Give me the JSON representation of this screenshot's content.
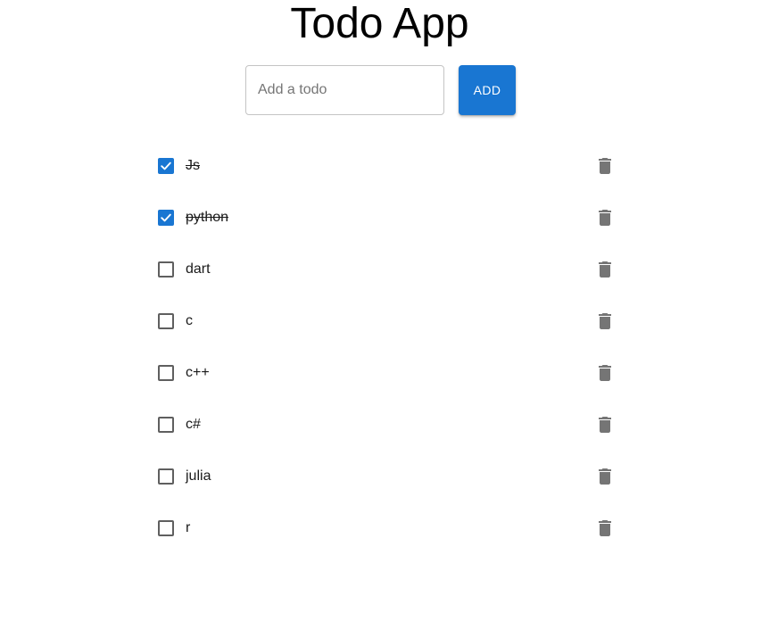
{
  "header": {
    "title": "Todo App"
  },
  "new_todo": {
    "placeholder": "Add a todo",
    "value": "",
    "add_label": "ADD"
  },
  "colors": {
    "accent": "#1976d2",
    "icon": "#757575",
    "checkbox_border": "#5f5f5f"
  },
  "todos": [
    {
      "text": "Js",
      "completed": true,
      "delete_icon": "trash-icon"
    },
    {
      "text": "python",
      "completed": true,
      "delete_icon": "trash-icon"
    },
    {
      "text": "dart",
      "completed": false,
      "delete_icon": "trash-icon"
    },
    {
      "text": "c",
      "completed": false,
      "delete_icon": "trash-icon"
    },
    {
      "text": "c++",
      "completed": false,
      "delete_icon": "trash-icon"
    },
    {
      "text": "c#",
      "completed": false,
      "delete_icon": "trash-icon"
    },
    {
      "text": "julia",
      "completed": false,
      "delete_icon": "trash-icon"
    },
    {
      "text": "r",
      "completed": false,
      "delete_icon": "trash-icon"
    }
  ]
}
